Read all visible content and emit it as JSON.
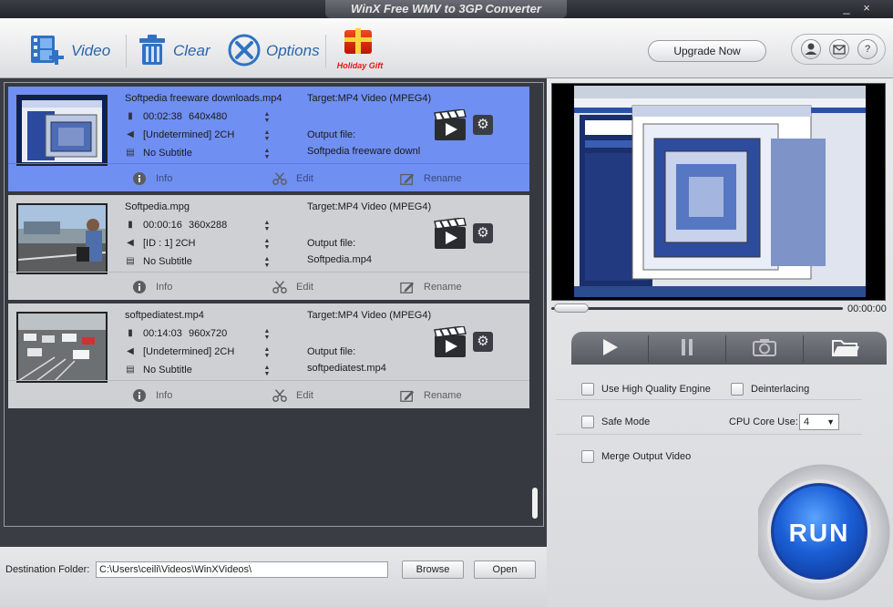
{
  "window": {
    "title": "WinX Free WMV to 3GP Converter",
    "minimize": "_",
    "close": "×"
  },
  "toolbar": {
    "video_label": "Video",
    "clear_label": "Clear",
    "options_label": "Options",
    "gift_label": "Holiday Gift",
    "upgrade_label": "Upgrade Now",
    "help_label": "?"
  },
  "items": [
    {
      "filename": "Softpedia freeware downloads.mp4",
      "duration": "00:02:38",
      "resolution": "640x480",
      "audio": "[Undetermined] 2CH",
      "subtitle": "No Subtitle",
      "target": "Target:MP4 Video (MPEG4)",
      "output_label": "Output file:",
      "output_file": "Softpedia freeware downl",
      "info": "Info",
      "edit": "Edit",
      "rename": "Rename"
    },
    {
      "filename": "Softpedia.mpg",
      "duration": "00:00:16",
      "resolution": "360x288",
      "audio": "[ID : 1] 2CH",
      "subtitle": "No Subtitle",
      "target": "Target:MP4 Video (MPEG4)",
      "output_label": "Output file:",
      "output_file": "Softpedia.mp4",
      "info": "Info",
      "edit": "Edit",
      "rename": "Rename"
    },
    {
      "filename": "softpediatest.mp4",
      "duration": "00:14:03",
      "resolution": "960x720",
      "audio": "[Undetermined] 2CH",
      "subtitle": "No Subtitle",
      "target": "Target:MP4 Video (MPEG4)",
      "output_label": "Output file:",
      "output_file": "softpediatest.mp4",
      "info": "Info",
      "edit": "Edit",
      "rename": "Rename"
    }
  ],
  "preview": {
    "time": "00:00:00"
  },
  "options": {
    "high_quality": "Use High Quality Engine",
    "deinterlacing": "Deinterlacing",
    "safe_mode": "Safe Mode",
    "cpu_label": "CPU Core Use:",
    "cpu_value": "4",
    "merge": "Merge Output Video"
  },
  "run_label": "RUN",
  "destination": {
    "label": "Destination Folder:",
    "path": "C:\\Users\\ceili\\Videos\\WinXVideos\\",
    "browse": "Browse",
    "open": "Open"
  },
  "colors": {
    "selected_row": "#6f8ff2",
    "row": "#cfd0d3",
    "accent": "#2a65a8",
    "run": "#1b5fd6"
  }
}
